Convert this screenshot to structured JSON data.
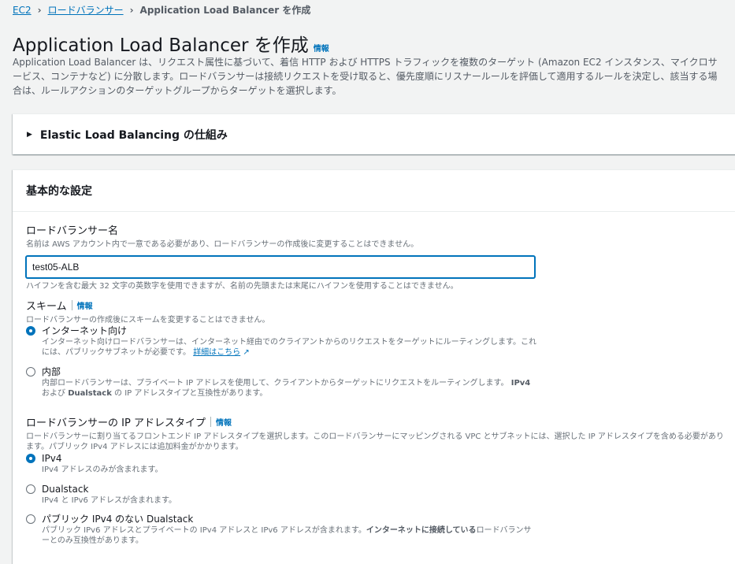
{
  "breadcrumb": {
    "items": [
      "EC2",
      "ロードバランサー"
    ],
    "current": "Application Load Balancer を作成"
  },
  "page": {
    "title": "Application Load Balancer を作成",
    "info": "情報",
    "description": "Application Load Balancer は、リクエスト属性に基づいて、着信 HTTP および HTTPS トラフィックを複数のターゲット (Amazon EC2 インスタンス、マイクロサービス、コンテナなど) に分散します。ロードバランサーは接続リクエストを受け取ると、優先度順にリスナールールを評価して適用するルールを決定し、該当する場合は、ルールアクションのターゲットグループからターゲットを選択します。"
  },
  "expandable": {
    "label": "Elastic Load Balancing の仕組み"
  },
  "basic": {
    "header": "基本的な設定",
    "name": {
      "label": "ロードバランサー名",
      "description": "名前は AWS アカウント内で一意である必要があり、ロードバランサーの作成後に変更することはできません。",
      "value": "test05-ALB",
      "constraint": "ハイフンを含む最大 32 文字の英数字を使用できますが、名前の先頭または末尾にハイフンを使用することはできません。"
    },
    "scheme": {
      "label": "スキーム",
      "info": "情報",
      "description": "ロードバランサーの作成後にスキームを変更することはできません。",
      "options": [
        {
          "label": "インターネット向け",
          "desc": "インターネット向けロードバランサーは、インターネット経由でのクライアントからのリクエストをターゲットにルーティングします。これには、パブリックサブネットが必要です。",
          "link": "詳細はこちら",
          "checked": true
        },
        {
          "label": "内部",
          "desc_a": "内部ロードバランサーは、プライベート IP アドレスを使用して、クライアントからターゲットにリクエストをルーティングします。",
          "desc_b": "IPv4",
          "desc_c": "および",
          "desc_d": "Dualstack",
          "desc_e": "の IP アドレスタイプと互換性があります。",
          "checked": false
        }
      ]
    },
    "ip_type": {
      "label": "ロードバランサーの IP アドレスタイプ",
      "info": "情報",
      "description": "ロードバランサーに割り当てるフロントエンド IP アドレスタイプを選択します。このロードバランサーにマッピングされる VPC とサブネットには、選択した IP アドレスタイプを含める必要があります。パブリック IPv4 アドレスには追加料金がかかります。",
      "options": [
        {
          "label": "IPv4",
          "desc": "IPv4 アドレスのみが含まれます。",
          "checked": true
        },
        {
          "label": "Dualstack",
          "desc": "IPv4 と IPv6 アドレスが含まれます。",
          "checked": false
        },
        {
          "label": "パブリック IPv4 のない Dualstack",
          "desc_a": "パブリック IPv6 アドレスとプライベートの IPv4 アドレスと IPv6 アドレスが含まれます。",
          "desc_b": "インターネットに接続している",
          "desc_c": "ロードバランサーとのみ互換性があります。",
          "checked": false
        }
      ]
    }
  },
  "colors": {
    "accent": "#0073bb",
    "text": "#16191f",
    "muted": "#687078"
  }
}
